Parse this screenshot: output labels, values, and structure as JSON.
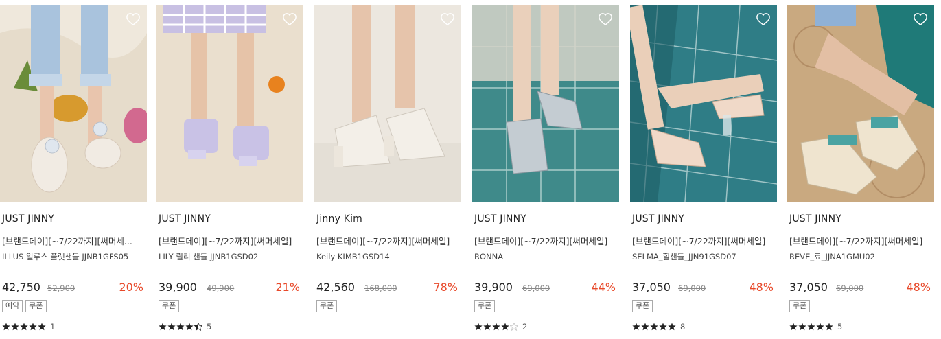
{
  "products": [
    {
      "brand": "JUST JINNY",
      "title": "[브랜드데이][~7/22까지][써머세...",
      "subtitle": "ILLUS 일루스 플랫샌들 JJNB1GFS05",
      "price": "42,750",
      "original_price": "52,900",
      "discount": "20%",
      "tags": [
        "예약",
        "쿠폰"
      ],
      "rating": 5,
      "review_count": "1",
      "image_desc": "clear flat sandals with jewel ornament",
      "bg": "#efe8dc"
    },
    {
      "brand": "JUST JINNY",
      "title": "[브랜드데이][~7/22까지][써머세일]",
      "subtitle": "LILY 릴리 샌들 JJNB1GSD02",
      "price": "39,900",
      "original_price": "49,900",
      "discount": "21%",
      "tags": [
        "쿠폰"
      ],
      "rating": 4.5,
      "review_count": "5",
      "image_desc": "lilac padded strap mules",
      "bg": "#eadfce"
    },
    {
      "brand": "Jinny Kim",
      "title": "[브랜드데이][~7/22까지][써머세일]",
      "subtitle": "Keily KIMB1GSD14",
      "price": "42,560",
      "original_price": "168,000",
      "discount": "78%",
      "tags": [
        "쿠폰"
      ],
      "rating": 0,
      "review_count": "",
      "image_desc": "white block heel sandals",
      "bg": "#ece7df"
    },
    {
      "brand": "JUST JINNY",
      "title": "[브랜드데이][~7/22까지][써머세일]",
      "subtitle": "RONNA",
      "price": "39,900",
      "original_price": "69,000",
      "discount": "44%",
      "tags": [
        "쿠폰"
      ],
      "rating": 4,
      "review_count": "2",
      "image_desc": "silver strap sandals on teal tiles",
      "bg": "#3f8a8a"
    },
    {
      "brand": "JUST JINNY",
      "title": "[브랜드데이][~7/22까지][써머세일]",
      "subtitle": "SELMA_힐샌들_JJN91GSD07",
      "price": "37,050",
      "original_price": "69,000",
      "discount": "48%",
      "tags": [
        "쿠폰"
      ],
      "rating": 5,
      "review_count": "8",
      "image_desc": "nude clear heel sandals on teal tiles",
      "bg": "#2f7d86"
    },
    {
      "brand": "JUST JINNY",
      "title": "[브랜드데이][~7/22까지][써머세일]",
      "subtitle": "REVE_료_JJNA1GMU02",
      "price": "37,050",
      "original_price": "69,000",
      "discount": "48%",
      "tags": [
        "쿠폰"
      ],
      "rating": 5,
      "review_count": "5",
      "image_desc": "cream pointed mules with woven strap",
      "bg": "#c9a980"
    }
  ],
  "colors": {
    "discount": "#e8492a",
    "star": "#222222",
    "star_empty": "#cccccc"
  },
  "icons": {
    "wishlist": "heart-outline-icon",
    "star": "star-icon"
  }
}
